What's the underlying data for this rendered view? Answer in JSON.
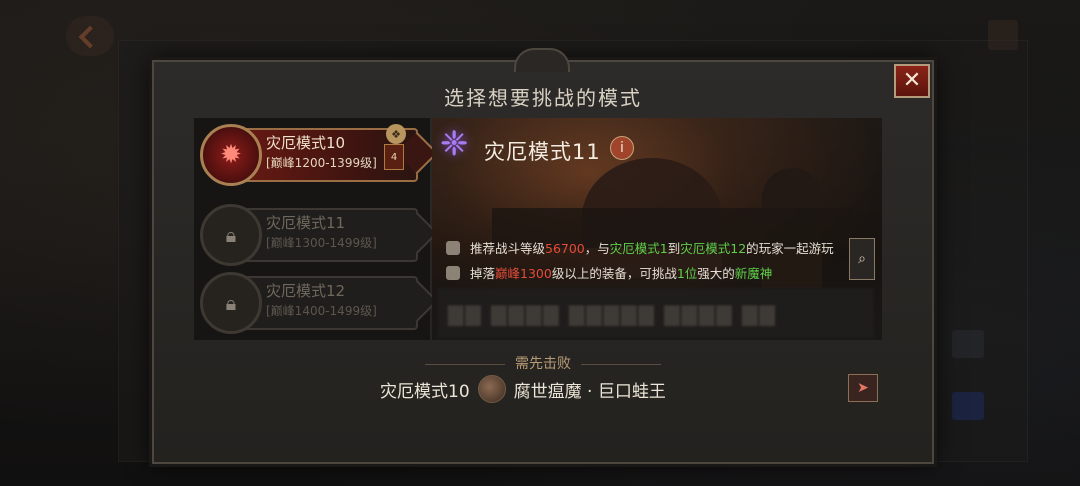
{
  "dialog": {
    "title": "选择想要挑战的模式",
    "close_label": "✕"
  },
  "mode_list": [
    {
      "name": "灾厄模式10",
      "range": "[巅峰1200-1399级]",
      "state": "selected",
      "badge": "4"
    },
    {
      "name": "灾厄模式11",
      "range": "[巅峰1300-1499级]",
      "state": "locked"
    },
    {
      "name": "灾厄模式12",
      "range": "[巅峰1400-1499级]",
      "state": "locked"
    }
  ],
  "detail": {
    "title": "灾厄模式11",
    "info_icon_label": "i",
    "req1": {
      "p1": "推荐战斗等级",
      "power": "56700",
      "p2": "，与",
      "mode_from": "灾厄模式1",
      "p3": "到",
      "mode_to": "灾厄模式12",
      "p4": "的玩家一起游玩"
    },
    "req2": {
      "p1": "掉落",
      "level": "巅峰1300",
      "p2": "级以上的装备，可挑战",
      "count": "1位",
      "p3": "强大的",
      "boss": "新魔神"
    }
  },
  "condition": {
    "label": "需先击败",
    "mode": "灾厄模式10",
    "boss_name": "腐世瘟魔 · 巨口蛙王"
  },
  "icons": {
    "emblem_active": "demon-crest-icon",
    "lock": "lock-icon",
    "crest": "purple-rune-icon",
    "shield": "shield-icon",
    "helmet": "helmet-icon",
    "preview": "magnifier-icon",
    "goto": "navigate-arrow-icon",
    "boss": "boss-portrait-icon"
  },
  "colors": {
    "accent_red": "#e34b3b",
    "accent_green": "#5fcf4a",
    "gold_border": "#9b6d45"
  }
}
